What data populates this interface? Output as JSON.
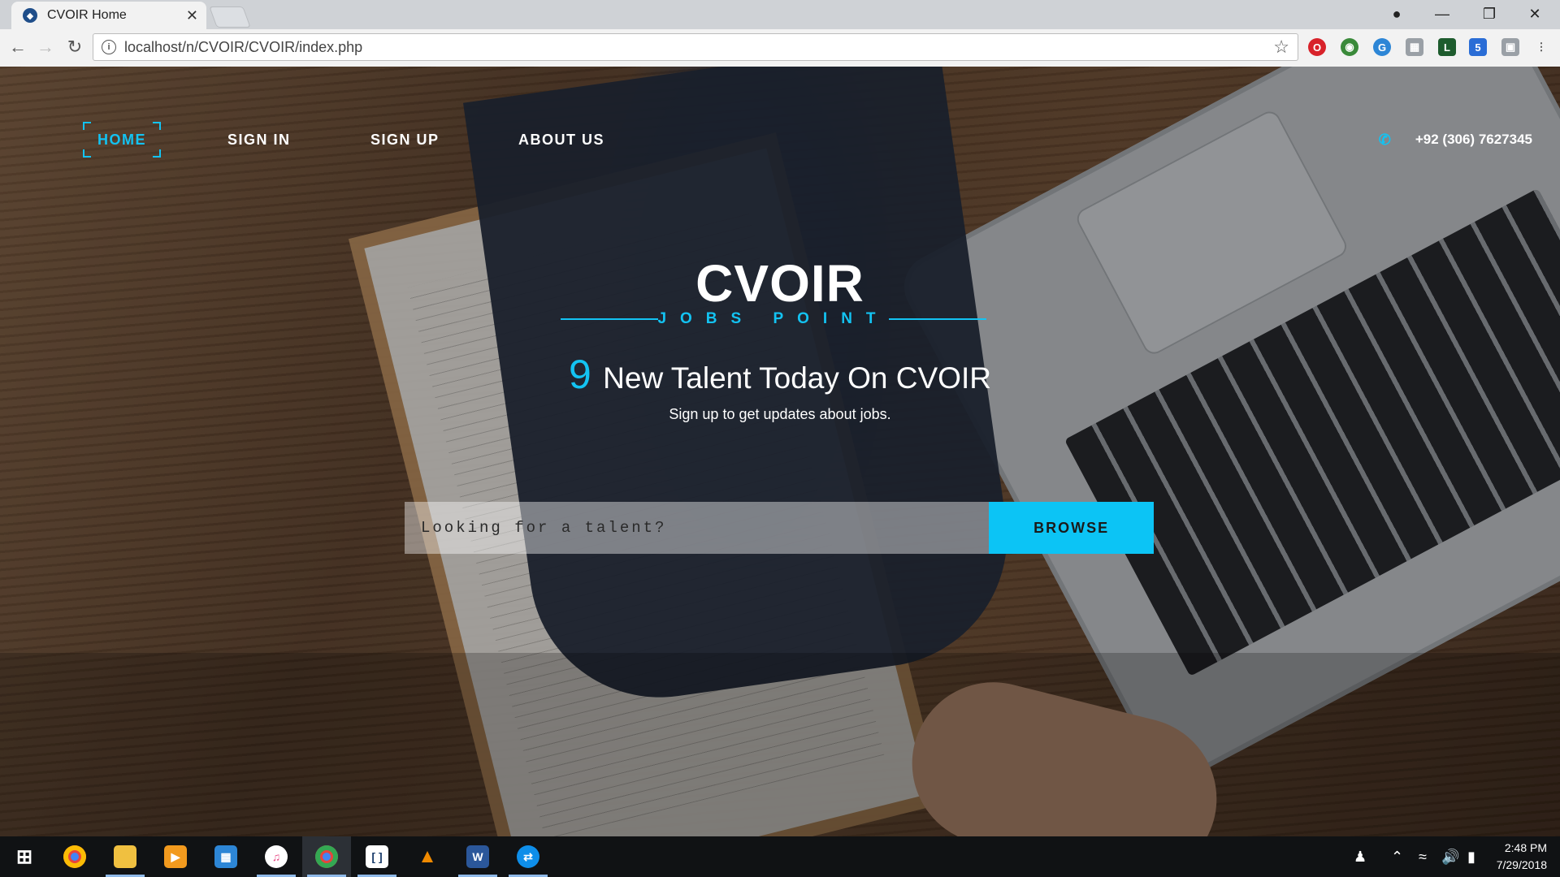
{
  "browser": {
    "tab_title": "CVOIR Home",
    "url": "localhost/n/CVOIR/CVOIR/index.php"
  },
  "nav": {
    "items": [
      {
        "label": "HOME",
        "active": true
      },
      {
        "label": "SIGN IN"
      },
      {
        "label": "SIGN UP"
      },
      {
        "label": "ABOUT US"
      }
    ],
    "phone": "+92 (306) 7627345"
  },
  "hero": {
    "brand": "CVOIR",
    "tagline": "JOBS POINT",
    "count": "9",
    "headline": "New Talent Today On CVOIR",
    "subline": "Sign up to get updates about jobs."
  },
  "search": {
    "placeholder": "Looking for a talent?",
    "button_label": "BROWSE"
  },
  "taskbar": {
    "time": "2:48 PM",
    "date": "7/29/2018"
  },
  "colors": {
    "accent": "#13c3f2",
    "browse_button": "#0cc4f5",
    "taskbar": "#101214"
  },
  "icons": [
    "shield-icon",
    "close-icon",
    "back-icon",
    "forward-icon",
    "reload-icon",
    "info-icon",
    "star-icon",
    "phone-icon",
    "windows-start-icon",
    "chrome-icon",
    "file-explorer-icon",
    "media-player-icon",
    "store-icon",
    "itunes-icon",
    "bracket-app-icon",
    "vlc-icon",
    "word-icon",
    "teamviewer-icon",
    "people-icon",
    "chevron-up-icon",
    "wifi-icon",
    "volume-icon",
    "battery-icon"
  ]
}
